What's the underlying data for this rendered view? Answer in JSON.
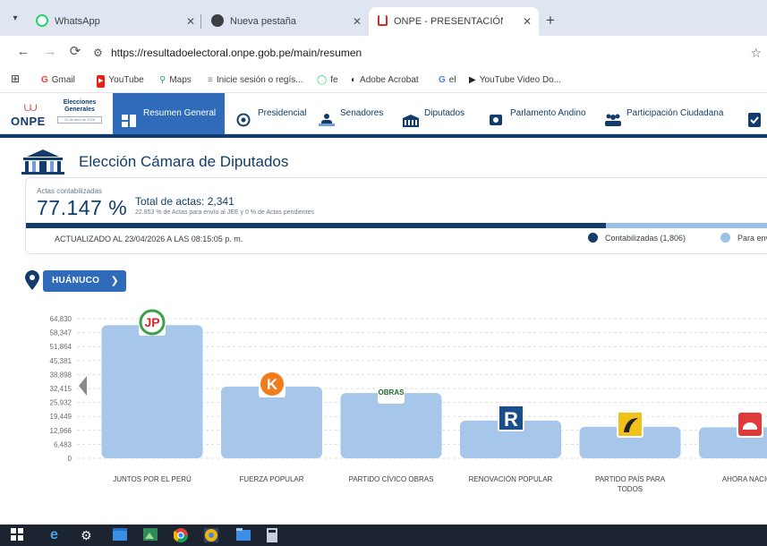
{
  "browser": {
    "tabs": [
      {
        "title": "WhatsApp",
        "icon": "whatsapp-icon"
      },
      {
        "title": "Nueva pestaña",
        "icon": "chrome-icon"
      },
      {
        "title": "ONPE - PRESENTACIÓN DE RE",
        "icon": "onpe-icon"
      }
    ],
    "url": "https://resultadoelectoral.onpe.gob.pe/main/resumen",
    "bookmarks": [
      {
        "label": "Gmail",
        "icon": "gmail-icon"
      },
      {
        "label": "YouTube",
        "icon": "youtube-icon"
      },
      {
        "label": "Maps",
        "icon": "maps-icon"
      },
      {
        "label": "Inicie sesión o regís...",
        "icon": "bookmark-icon"
      },
      {
        "label": "fe",
        "icon": "whatsapp-icon"
      },
      {
        "label": "Adobe Acrobat",
        "icon": "acrobat-icon"
      },
      {
        "label": "el",
        "icon": "google-icon"
      },
      {
        "label": "YouTube Video Do...",
        "icon": "play-icon"
      }
    ]
  },
  "site": {
    "logo_text": "ONPE",
    "eg_title": "Elecciones Generales",
    "eg_date": "12 de abril de 2026",
    "menu": [
      "Resumen General",
      "Presidencial",
      "Senadores",
      "Diputados",
      "Parlamento Andino",
      "Participación Ciudadana"
    ]
  },
  "page": {
    "title": "Elección Cámara de Diputados",
    "actas_caption": "Actas contabilizadas",
    "actas_pct": "77.147 %",
    "actas_total": "Total de actas: 2,341",
    "actas_note": "22.853 % de Actas para envío al JEE y 0 % de Actas pendientes",
    "actas_fraction": 0.77147,
    "updated": "ACTUALIZADO AL 23/04/2026 A LAS 08:15:05 p. m.",
    "legend": [
      {
        "label": "Contabilizadas (1,806)",
        "color": "#123c6b"
      },
      {
        "label": "Para envío",
        "color": "#9bc1e8"
      }
    ],
    "region": "HUÁNUCO"
  },
  "chart_data": {
    "type": "bar",
    "categories": [
      "JUNTOS POR EL PERÚ",
      "FUERZA POPULAR",
      "PARTIDO CÍVICO OBRAS",
      "RENOVACIÓN POPULAR",
      "PARTIDO PAÍS PARA TODOS",
      "AHORA NACIÓN"
    ],
    "values": [
      61800,
      33300,
      30300,
      17500,
      14600,
      14400
    ],
    "yticks": [
      "64,830",
      "58,347",
      "51,864",
      "45,381",
      "38,898",
      "32,415",
      "25,932",
      "19,449",
      "12,966",
      "6,483",
      "0"
    ],
    "ylim": [
      0,
      64830
    ],
    "bar_color": "#a7c7ea",
    "logos": [
      "JP",
      "K",
      "OBRAS",
      "R",
      "PPT",
      "AN"
    ],
    "grid": true
  }
}
